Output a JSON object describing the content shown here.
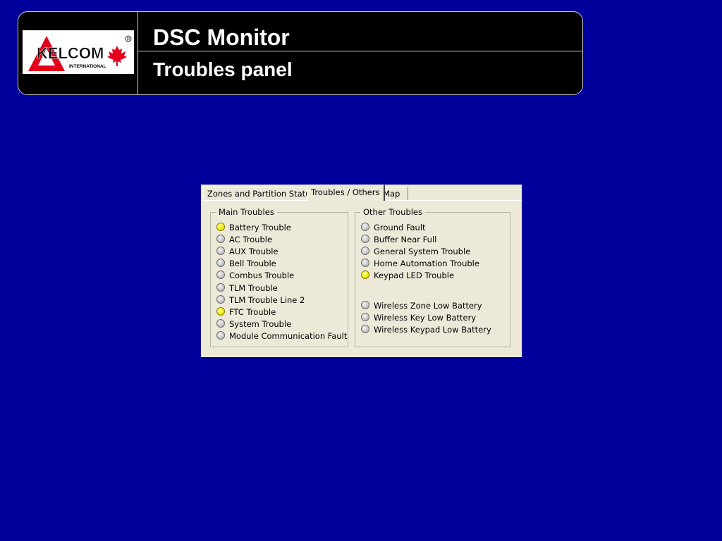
{
  "header": {
    "title": "DSC Monitor",
    "subtitle": "Troubles panel",
    "logo_text": "KELCOM",
    "logo_subtext": "INTERNATIONAL"
  },
  "tabs": [
    {
      "label": "Zones and Partition Status",
      "active": false
    },
    {
      "label": "Troubles / Others",
      "active": true
    },
    {
      "label": "Map",
      "active": false
    }
  ],
  "main_troubles": {
    "legend": "Main Troubles",
    "items": [
      {
        "label": "Battery Trouble",
        "on": true
      },
      {
        "label": "AC Trouble",
        "on": false
      },
      {
        "label": "AUX Trouble",
        "on": false
      },
      {
        "label": "Bell Trouble",
        "on": false
      },
      {
        "label": "Combus Trouble",
        "on": false
      },
      {
        "label": "TLM Trouble",
        "on": false
      },
      {
        "label": "TLM Trouble Line 2",
        "on": false
      },
      {
        "label": "FTC Trouble",
        "on": true
      },
      {
        "label": "System Trouble",
        "on": false
      },
      {
        "label": "Module Communication Fault",
        "on": false
      }
    ]
  },
  "other_troubles": {
    "legend": "Other Troubles",
    "items": [
      {
        "label": "Ground Fault",
        "on": false
      },
      {
        "label": "Buffer Near Full",
        "on": false
      },
      {
        "label": "General System Trouble",
        "on": false
      },
      {
        "label": "Home Automation Trouble",
        "on": false
      },
      {
        "label": "Keypad LED Trouble",
        "on": true
      },
      {
        "label": "Wireless Zone Low Battery",
        "on": false
      },
      {
        "label": "Wireless Key Low Battery",
        "on": false
      },
      {
        "label": "Wireless Keypad Low Battery",
        "on": false
      }
    ]
  },
  "colors": {
    "background": "#02009a",
    "led_on": "#f2f200",
    "led_off": "#bdbdbd"
  }
}
